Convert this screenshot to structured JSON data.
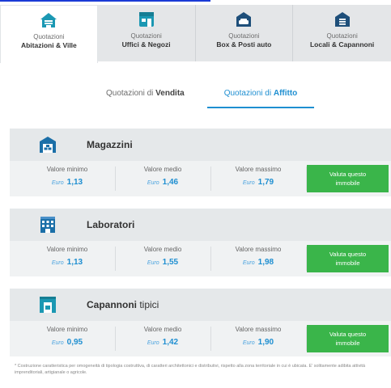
{
  "tabs": [
    {
      "sub": "Quotazioni",
      "main": "Abitazioni & Ville",
      "icon": "house-icon",
      "active": true
    },
    {
      "sub": "Quotazioni",
      "main": "Uffici & Negozi",
      "icon": "shop-icon",
      "active": false
    },
    {
      "sub": "Quotazioni",
      "main": "Box & Posti auto",
      "icon": "garage-car-icon",
      "active": false
    },
    {
      "sub": "Quotazioni",
      "main": "Locali & Capannoni",
      "icon": "warehouse-icon",
      "active": false
    }
  ],
  "mode_switch": {
    "vendita": {
      "prefix": "Quotazioni di ",
      "bold": "Vendita",
      "active": false
    },
    "affitto": {
      "prefix": "Quotazioni di ",
      "bold": "Affitto",
      "active": true
    }
  },
  "labels": {
    "min": "Valore minimo",
    "avg": "Valore medio",
    "max": "Valore massimo",
    "currency": "Euro",
    "button": "Valuta questo immobile"
  },
  "categories": [
    {
      "title_bold": "Magazzini",
      "title_rest": "",
      "icon": "warehouse-box-icon",
      "min": "1,13",
      "avg": "1,46",
      "max": "1,79"
    },
    {
      "title_bold": "Laboratori",
      "title_rest": "",
      "icon": "factory-building-icon",
      "min": "1,13",
      "avg": "1,55",
      "max": "1,98"
    },
    {
      "title_bold": "Capannoni",
      "title_rest": " tipici",
      "icon": "hangar-icon",
      "min": "0,95",
      "avg": "1,42",
      "max": "1,90"
    }
  ],
  "footnote": "* Costruzione caratteristica per omogeneità di tipologia costruttiva, di caratteri architettonici e distributivi, rispetto alla zona territoriale in cui è ubicata. E' solitamente adibita attività imprenditoriali, artigianale o agricole.",
  "colors": {
    "accent_blue": "#1f8fd1",
    "button_green": "#3ab54a",
    "icon_teal": "#1b98b3",
    "icon_navy": "#1e4f7a"
  }
}
